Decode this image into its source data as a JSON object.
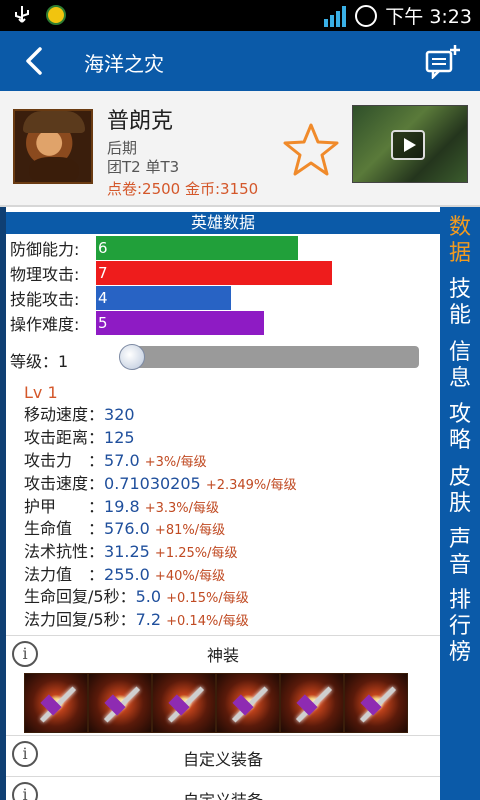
{
  "status_bar": {
    "time": "下午 3:23"
  },
  "titlebar": {
    "title": "海洋之灾"
  },
  "hero": {
    "name": "普朗克",
    "stage": "后期",
    "position": "团T2 单T3",
    "price": "点卷:2500 金币:3150"
  },
  "sidebar": {
    "items": [
      {
        "label": "数据",
        "active": true
      },
      {
        "label": "技能"
      },
      {
        "label": "信息"
      },
      {
        "label": "攻略"
      },
      {
        "label": "皮肤"
      },
      {
        "label": "声音"
      },
      {
        "label": "排行榜"
      }
    ],
    "active_color": "#f29b1f"
  },
  "section": {
    "title": "英雄数据"
  },
  "ratings": [
    {
      "label": "防御能力:",
      "value": "6",
      "color": "#21a03a"
    },
    {
      "label": "物理攻击:",
      "value": "7",
      "color": "#ee1c1c"
    },
    {
      "label": "技能攻击:",
      "value": "4",
      "color": "#2863c4"
    },
    {
      "label": "操作难度:",
      "value": "5",
      "color": "#8e1bc4"
    }
  ],
  "level": {
    "label": "等级：1",
    "value": 1
  },
  "attributes": {
    "lv": "Lv 1",
    "rows": [
      {
        "label": "移动速度：",
        "value": "320",
        "growth": ""
      },
      {
        "label": "攻击距离：",
        "value": "125",
        "growth": ""
      },
      {
        "label": "攻击力　：",
        "value": "57.0",
        "growth": "+3%/每级"
      },
      {
        "label": "攻击速度：",
        "value": "0.71030205",
        "growth": "+2.349%/每级"
      },
      {
        "label": "护甲　　：",
        "value": "19.8",
        "growth": "+3.3%/每级"
      },
      {
        "label": "生命值　：",
        "value": "576.0",
        "growth": "+81%/每级"
      },
      {
        "label": "法术抗性：",
        "value": "31.25",
        "growth": "+1.25%/每级"
      },
      {
        "label": "法力值　：",
        "value": "255.0",
        "growth": "+40%/每级"
      },
      {
        "label": "生命回复/5秒：",
        "value": "5.0",
        "growth": "+0.15%/每级"
      },
      {
        "label": "法力回复/5秒：",
        "value": "7.2",
        "growth": "+0.14%/每级"
      }
    ]
  },
  "equipment": {
    "title": "神装",
    "item_count": 6,
    "custom_rows": [
      {
        "label": "自定义装备"
      },
      {
        "label": "自定义装备"
      }
    ]
  },
  "colors": {
    "primary": "#0b5aa8",
    "accent": "#d4572a",
    "star": "#f08a2a"
  }
}
